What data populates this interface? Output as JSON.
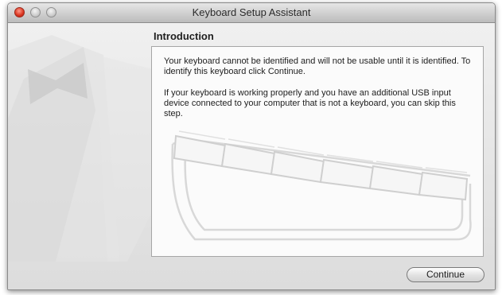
{
  "window": {
    "title": "Keyboard Setup Assistant",
    "controls": [
      "close-icon",
      "minimize-icon",
      "zoom-icon"
    ]
  },
  "page": {
    "heading": "Introduction",
    "paragraph_1": "Your keyboard cannot be identified and will not be usable until it is identified. To identify this keyboard click Continue.",
    "paragraph_2": "If your keyboard is working properly and you have an additional USB input device connected to your computer that is not a keyboard, you can skip this step."
  },
  "buttons": {
    "continue_label": "Continue"
  },
  "colors": {
    "close_button": "#d9331e",
    "panel_background": "#fbfbfb",
    "window_background": "#e8e8e8"
  }
}
